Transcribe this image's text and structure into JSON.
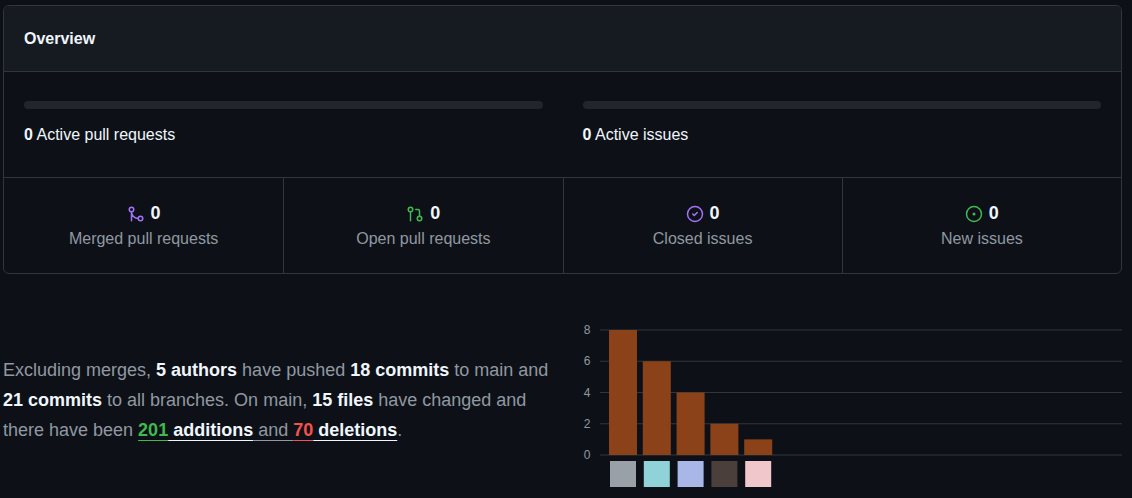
{
  "overview": {
    "title": "Overview"
  },
  "activity": [
    {
      "count": "0",
      "label": "Active pull requests",
      "level": 0
    },
    {
      "count": "0",
      "label": "Active issues",
      "level": 0
    }
  ],
  "stats": [
    {
      "count": "0",
      "label": "Merged pull requests",
      "color": "#a371f7"
    },
    {
      "count": "0",
      "label": "Open pull requests",
      "color": "#3fb950"
    },
    {
      "count": "0",
      "label": "Closed issues",
      "color": "#a371f7"
    },
    {
      "count": "0",
      "label": "New issues",
      "color": "#3fb950"
    }
  ],
  "summary": [
    {
      "text": "Excluding merges, ",
      "kind": "plain",
      "link": false
    },
    {
      "text": "5 authors",
      "kind": "strong",
      "link": false
    },
    {
      "text": " have pushed ",
      "kind": "plain",
      "link": false
    },
    {
      "text": "18 commits",
      "kind": "strong",
      "link": false
    },
    {
      "text": " to main and ",
      "kind": "plain",
      "link": false
    },
    {
      "text": "21 commits",
      "kind": "strong",
      "link": false
    },
    {
      "text": " to all branches. On main, ",
      "kind": "plain",
      "link": false
    },
    {
      "text": "15 files",
      "kind": "strong",
      "link": false
    },
    {
      "text": " have changed and there have been ",
      "kind": "plain",
      "link": false
    },
    {
      "text": "201",
      "kind": "added",
      "link": true
    },
    {
      "text": " additions",
      "kind": "strong",
      "link": true
    },
    {
      "text": " and ",
      "kind": "plain",
      "link": true
    },
    {
      "text": "70",
      "kind": "deleted",
      "link": true
    },
    {
      "text": " deletions",
      "kind": "strong",
      "link": true
    },
    {
      "text": ".",
      "kind": "plain",
      "link": false
    }
  ],
  "chart": {
    "ticks": [
      "8",
      "6",
      "4",
      "2",
      "0"
    ],
    "values": [
      8,
      6,
      4,
      2,
      1
    ],
    "authors": [
      {
        "color": "#9aa0a8"
      },
      {
        "color": "#8fd3d8"
      },
      {
        "color": "#a9b6e8"
      },
      {
        "color": "#4a3f3a"
      },
      {
        "color": "#f0c8cc"
      }
    ]
  }
}
